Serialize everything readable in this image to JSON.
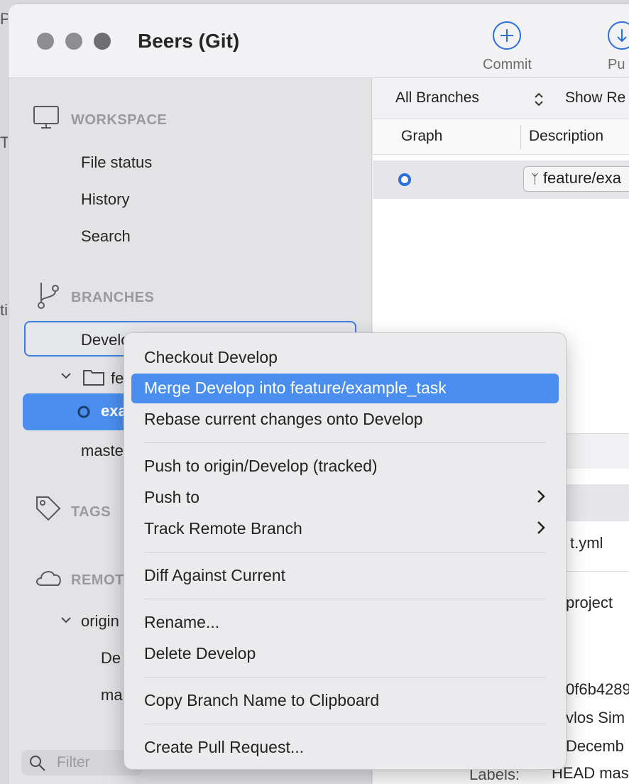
{
  "window": {
    "title": "Beers (Git)"
  },
  "toolbar": {
    "commit_label": "Commit",
    "pull_label": "Pu"
  },
  "sidebar": {
    "workspace_header": "WORKSPACE",
    "workspace_items": [
      "File status",
      "History",
      "Search"
    ],
    "branches_header": "BRANCHES",
    "branch_develop": "Develop",
    "folder_feature": "fe",
    "branch_selected": "exa",
    "branch_master": "maste",
    "tags_header": "TAGS",
    "remotes_header": "REMOTE",
    "remote_origin": "origin",
    "remote_items": [
      "De",
      "ma"
    ],
    "filter_placeholder": "Filter"
  },
  "main": {
    "branch_filter": "All Branches",
    "show_label": "Show Re",
    "col_graph": "Graph",
    "col_description": "Description",
    "ref_tag": "feature/exa",
    "peek": {
      "file": "t.yml",
      "project": "project",
      "hash": "0f6b4289",
      "author": "vlos Sim",
      "date": "Decemb",
      "labels_key": "Labels:",
      "labels_value": "HEAD mas"
    }
  },
  "context_menu": {
    "items": [
      {
        "label": "Checkout Develop"
      },
      {
        "label": "Merge Develop into feature/example_task"
      },
      {
        "label": "Rebase current changes onto Develop"
      },
      {
        "label": "Push to origin/Develop (tracked)"
      },
      {
        "label": "Push to"
      },
      {
        "label": "Track Remote Branch"
      },
      {
        "label": "Diff Against Current"
      },
      {
        "label": "Rename..."
      },
      {
        "label": "Delete Develop"
      },
      {
        "label": "Copy Branch Name to Clipboard"
      },
      {
        "label": "Create Pull Request..."
      }
    ]
  },
  "background": {
    "frag1": "Pa",
    "frag2": "Ti",
    "frag3": "ti"
  },
  "colors": {
    "accent": "#4a8ff0",
    "focus_ring": "#3c7de0",
    "commit_icon": "#2a6fdb"
  }
}
